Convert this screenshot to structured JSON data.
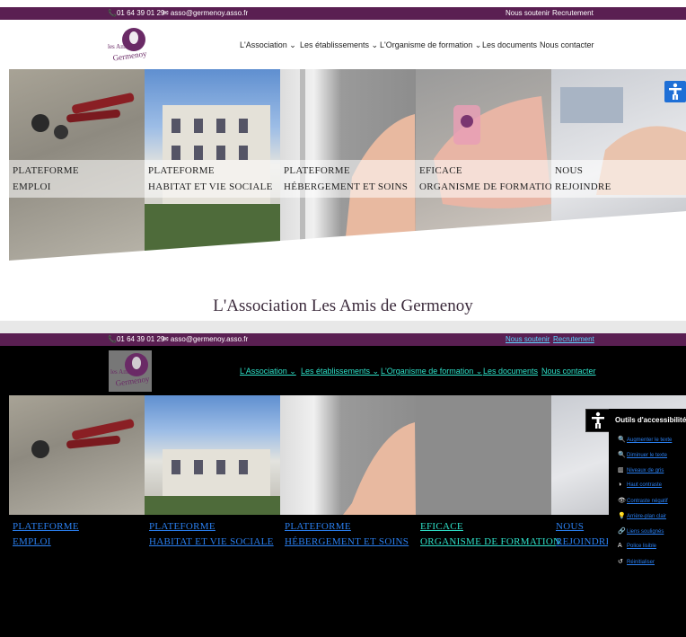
{
  "top": {
    "phone": "📞01 64 39 01 29",
    "email": "✉ asso@germenoy.asso.fr",
    "support": "Nous soutenir",
    "recruit": "Recrutement",
    "logo_text": "les Amis de Germenoy",
    "nav": [
      "L'Association ⌄",
      "Les établissements ⌄",
      "L'Organisme de formation ⌄",
      "Les documents",
      "Nous contacter"
    ],
    "panels": [
      {
        "l1": "PLATEFORME",
        "l2": "EMPLOI"
      },
      {
        "l1": "PLATEFORME",
        "l2": "HABITAT ET VIE SOCIALE"
      },
      {
        "l1": "PLATEFORME",
        "l2": "HÉBERGEMENT ET SOINS"
      },
      {
        "l1": "EFICACE",
        "l2": "ORGANISME DE FORMATION"
      },
      {
        "l1": "NOUS",
        "l2": "REJOINDRE"
      }
    ],
    "section_title": "L'Association Les Amis de Germenoy"
  },
  "bottom": {
    "phone": "📞01 64 39 01 29",
    "email": "✉ asso@germenoy.asso.fr",
    "support": "Nous soutenir",
    "recruit": "Recrutement",
    "nav": [
      "L'Association ⌄",
      "Les établissements ⌄",
      "L'Organisme de formation ⌄",
      "Les documents",
      "Nous contacter"
    ],
    "panels": [
      {
        "l1": "PLATEFORME",
        "l2": "EMPLOI"
      },
      {
        "l1": "PLATEFORME",
        "l2": "HABITAT ET VIE SOCIALE"
      },
      {
        "l1": "PLATEFORME",
        "l2": "HÉBERGEMENT ET SOINS"
      },
      {
        "l1": "EFICACE",
        "l2": "ORGANISME DE FORMATION"
      },
      {
        "l1": "NOUS",
        "l2": "REJOINDRE"
      }
    ],
    "tools_title": "Outils d'accessibilité",
    "tools": [
      {
        "icon": "🔍",
        "label": "Augmenter le texte"
      },
      {
        "icon": "🔍",
        "label": "Diminuer le texte"
      },
      {
        "icon": "▥",
        "label": "Niveaux de gris"
      },
      {
        "icon": "◑",
        "label": "Haut contraste"
      },
      {
        "icon": "👁",
        "label": "Contraste négatif"
      },
      {
        "icon": "💡",
        "label": "Arrière-plan clair"
      },
      {
        "icon": "🔗",
        "label": "Liens soulignés"
      },
      {
        "icon": "A",
        "label": "Police lisible"
      },
      {
        "icon": "↺",
        "label": "Réinitialiser"
      }
    ]
  },
  "colors": {
    "brand": "#5a1f52",
    "accessibility_blue": "#1e6fd6",
    "contrast_link": "#2ee0c8"
  }
}
